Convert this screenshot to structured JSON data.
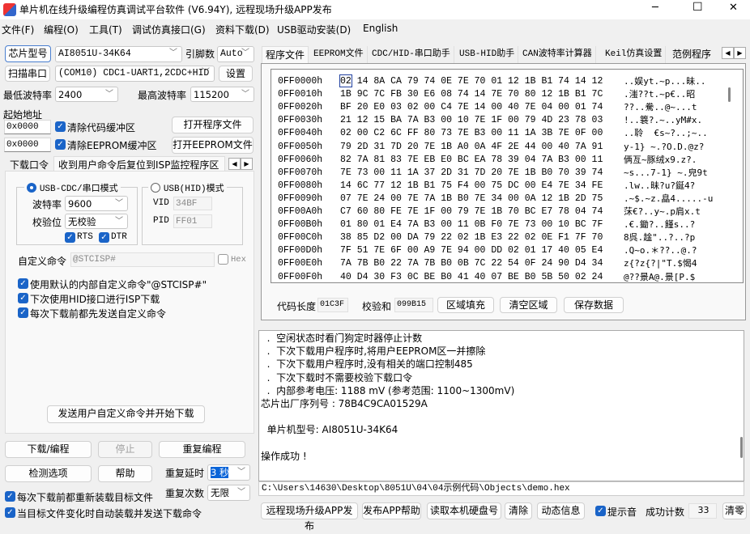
{
  "window": {
    "title": "单片机在线升级编程仿真调试平台软件 (V6.94Y), 远程现场升级APP发布",
    "min": "─",
    "max": "☐",
    "close": "✕"
  },
  "menu": [
    "文件(F)",
    "编程(O)",
    "工具(T)",
    "调试仿真接口(G)",
    "资料下载(D)",
    "USB驱动安装(D)",
    "English"
  ],
  "left": {
    "chip_button": "芯片型号",
    "chip_value": "AI8051U-34K64",
    "pins_label": "引脚数",
    "pins_value": "Auto",
    "scan_button": "扫描串口",
    "port_value": "(COM10) CDC1-UART1,2CDC+HID",
    "settings_button": "设置",
    "min_baud_label": "最低波特率",
    "min_baud_value": "2400",
    "max_baud_label": "最高波特率",
    "max_baud_value": "115200",
    "start_addr_label": "起始地址",
    "addr1": "0x0000",
    "clear_code": "清除代码缓冲区",
    "open_prog": "打开程序文件",
    "addr2": "0x0000",
    "clear_eeprom": "清除EEPROM缓冲区",
    "open_eeprom": "打开EEPROM文件",
    "tabs": [
      "下载口令",
      "收到用户命令后复位到ISP监控程序区"
    ],
    "cdc_mode": "USB-CDC/串口模式",
    "baud_label": "波特率",
    "baud_value": "9600",
    "parity_label": "校验位",
    "parity_value": "无校验",
    "rts": "RTS",
    "dtr": "DTR",
    "hid_mode": "USB(HID)模式",
    "vid_label": "VID",
    "vid_value": "34BF",
    "pid_label": "PID",
    "pid_value": "FF01",
    "custom_cmd_label": "自定义命令",
    "custom_cmd_value": "@STCISP#",
    "hex_label": "Hex",
    "options": [
      "使用默认的内部自定义命令\"@STCISP#\"",
      "下次使用HID接口进行ISP下载",
      "每次下载前都先发送自定义命令"
    ],
    "send_button": "发送用户自定义命令并开始下载",
    "download_button": "下载/编程",
    "stop_button": "停止",
    "repeat_button": "重复编程",
    "check_button": "检测选项",
    "help_button": "帮助",
    "repeat_delay_label": "重复延时",
    "repeat_delay_value": "3 秒",
    "repeat_count_label": "重复次数",
    "repeat_count_value": "无限",
    "reload_each": "每次下载前都重新装载目标文件",
    "auto_reload": "当目标文件变化时自动装载并发送下载命令"
  },
  "right": {
    "tabs": [
      "程序文件",
      "EEPROM文件",
      "CDC/HID-串口助手",
      "USB-HID助手",
      "CAN波特率计算器",
      "Keil仿真设置",
      "范例程序"
    ],
    "hex_rows": [
      {
        "addr": "0FF0000h",
        "bytes": "02 14 8A CA 79 74 0E 7E 70 01 12 1B B1 74 14 12",
        "ascii": "..娱yt.~p...昧.."
      },
      {
        "addr": "0FF0010h",
        "bytes": "1B 9C 7C FB 30 E6 08 74 14 7E 70 80 12 1B B1 7C",
        "ascii": ".滍??t.~p€..昭"
      },
      {
        "addr": "0FF0020h",
        "bytes": "BF 20 E0 03 02 00 C4 7E 14 00 40 7E 04 00 01 74",
        "ascii": "??..駦..@~...t"
      },
      {
        "addr": "0FF0030h",
        "bytes": "21 12 15 BA 7A B3 00 10 7E 1F 00 79 4D 23 78 03",
        "ascii": "!..簔?.~..yM#x."
      },
      {
        "addr": "0FF0040h",
        "bytes": "02 00 C2 6C FF 80 73 7E B3 00 11 1A 3B 7E 0F 00",
        "ascii": "..聆  €s~?..;~.."
      },
      {
        "addr": "0FF0050h",
        "bytes": "79 2D 31 7D 20 7E 1B A0 0A 4F 2E 44 00 40 7A 91",
        "ascii": "y-1} ~.?O.D.@z?"
      },
      {
        "addr": "0FF0060h",
        "bytes": "82 7A 81 83 7E EB E0 BC EA 78 39 04 7A B3 00 11",
        "ascii": "俩亙~豚绒x9.z?."
      },
      {
        "addr": "0FF0070h",
        "bytes": "7E 73 00 11 1A 37 2D 31 7D 20 7E 1B B0 70 39 74",
        "ascii": "~s...7-1} ~.皃9t"
      },
      {
        "addr": "0FF0080h",
        "bytes": "14 6C 77 12 1B B1 75 F4 00 75 DC 00 E4 7E 34 FE",
        "ascii": ".lw..昧?u?鋋4?"
      },
      {
        "addr": "0FF0090h",
        "bytes": "07 7E 24 00 7E 7A 1B B0 7E 34 00 0A 12 1B 2D 75",
        "ascii": ".~$.~z.皛4.....-u"
      },
      {
        "addr": "0FF00A0h",
        "bytes": "C7 60 80 FE 7E 1F 00 79 7E 1B 70 BC E7 78 04 74",
        "ascii": "莯€?..y~.p肩x.t"
      },
      {
        "addr": "0FF00B0h",
        "bytes": "01 80 01 E4 7A B3 00 11 0B F0 7E 73 00 10 BC 7F",
        "ascii": ".€.鋤?..饉s..?"
      },
      {
        "addr": "0FF00C0h",
        "bytes": "38 85 D2 00 DA 79 22 02 1B E3 22 02 0E F1 7F 70",
        "ascii": "8呉.趛\"..?..?p"
      },
      {
        "addr": "0FF00D0h",
        "bytes": "7F 51 7E 6F 00 A9 7E 94 00 DD 02 01 17 40 05 E4",
        "ascii": ".Q~o.＊??..@.?"
      },
      {
        "addr": "0FF00E0h",
        "bytes": "7A 7B B0 22 7A 7B B0 0B 7C 22 54 0F 24 90 D4 34",
        "ascii": "z{?z{?|\"T.$愒4"
      },
      {
        "addr": "0FF00F0h",
        "bytes": "40 D4 30 F3 0C BE B0 41 40 07 BE B0 5B 50 02 24",
        "ascii": "@??景A@.景[P.$"
      }
    ],
    "code_len_label": "代码长度",
    "code_len_value": "01C3F",
    "checksum_label": "校验和",
    "checksum_value": "099B15",
    "fill_button": "区域填充",
    "clear_area_button": "清空区域",
    "save_button": "保存数据",
    "log": [
      "  .  空闲状态时看门狗定时器停止计数",
      "  .  下次下载用户程序时,将用户EEPROM区一并擦除",
      "  .  下次下载用户程序时,没有相关的端口控制485",
      "  .  下次下载时不需要校验下载口令",
      "  .  内部参考电压: 1188 mV (参考范围: 1100~1300mV)",
      "芯片出厂序列号 : 78B4C9CA01529A",
      "",
      "  单片机型号: AI8051U-34K64",
      "",
      "操作成功 !"
    ],
    "path": "C:\\Users\\14630\\Desktop\\8051U\\04\\04示例代码\\Objects\\demo.hex",
    "bottom": {
      "publish": "远程现场升级APP发布",
      "publish_help": "发布APP帮助",
      "read_disk": "读取本机硬盘号",
      "clear": "清除",
      "dynamic": "动态信息",
      "beep": "提示音",
      "success_label": "成功计数",
      "success_value": "33",
      "reset": "清零"
    }
  }
}
